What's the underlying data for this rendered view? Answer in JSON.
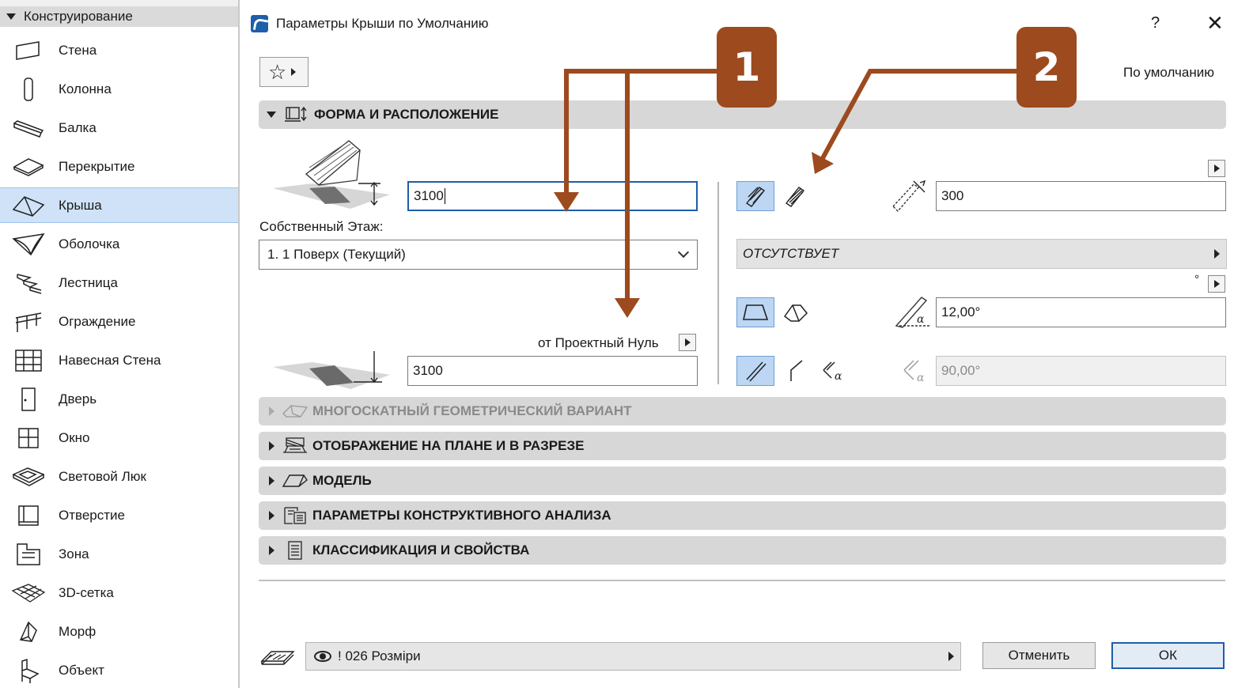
{
  "sidebar": {
    "header": "Конструирование",
    "items": [
      {
        "label": "Стена",
        "icon": "wall-icon"
      },
      {
        "label": "Колонна",
        "icon": "column-icon"
      },
      {
        "label": "Балка",
        "icon": "beam-icon"
      },
      {
        "label": "Перекрытие",
        "icon": "slab-icon"
      },
      {
        "label": "Крыша",
        "icon": "roof-icon",
        "selected": true
      },
      {
        "label": "Оболочка",
        "icon": "shell-icon"
      },
      {
        "label": "Лестница",
        "icon": "stair-icon"
      },
      {
        "label": "Ограждение",
        "icon": "railing-icon"
      },
      {
        "label": "Навесная Стена",
        "icon": "curtain-wall-icon"
      },
      {
        "label": "Дверь",
        "icon": "door-icon"
      },
      {
        "label": "Окно",
        "icon": "window-icon"
      },
      {
        "label": "Световой Люк",
        "icon": "skylight-icon"
      },
      {
        "label": "Отверстие",
        "icon": "opening-icon"
      },
      {
        "label": "Зона",
        "icon": "zone-icon"
      },
      {
        "label": "3D-сетка",
        "icon": "mesh-icon"
      },
      {
        "label": "Морф",
        "icon": "morph-icon"
      },
      {
        "label": "Объект",
        "icon": "object-icon"
      }
    ]
  },
  "dialog": {
    "title": "Параметры Крыши по Умолчанию",
    "help": "?",
    "close": "✕",
    "favorites_star": "☆",
    "default_label": "По умолчанию"
  },
  "shape_panel": {
    "title": "ФОРМА И РАСПОЛОЖЕНИЕ",
    "top_height": "3100",
    "home_story_label": "Собственный Этаж:",
    "home_story_value": "1. 1 Поверх (Текущий)",
    "reference_label": "от Проектный Нуль",
    "bottom_height": "3100",
    "thickness": "300",
    "material": "ОТСУТСТВУЕТ",
    "degree_symbol": "°",
    "pitch": "12,00°",
    "edge_angle": "90,00°"
  },
  "panels": [
    {
      "title": "МНОГОСКАТНЫЙ ГЕОМЕТРИЧЕСКИЙ ВАРИАНТ",
      "disabled": true
    },
    {
      "title": "ОТОБРАЖЕНИЕ НА ПЛАНЕ И В РАЗРЕЗЕ"
    },
    {
      "title": "МОДЕЛЬ"
    },
    {
      "title": "ПАРАМЕТРЫ КОНСТРУКТИВНОГО АНАЛИЗА"
    },
    {
      "title": "КЛАССИФИКАЦИЯ И СВОЙСТВА"
    }
  ],
  "footer": {
    "layer": "! 026 Розміри",
    "cancel": "Отменить",
    "ok": "ОК"
  },
  "annotations": {
    "badge1": "1",
    "badge2": "2",
    "color": "#9c4a1e"
  }
}
